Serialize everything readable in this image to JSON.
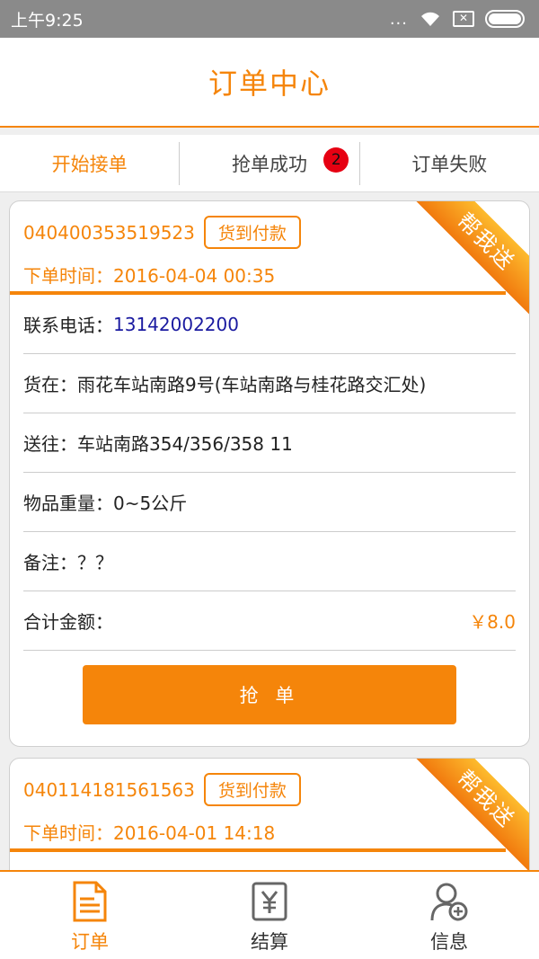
{
  "status_bar": {
    "time": "上午9:25",
    "dots": "...",
    "sim": "✕"
  },
  "header": {
    "title": "订单中心"
  },
  "tabs": [
    {
      "label": "开始接单",
      "active": true
    },
    {
      "label": "抢单成功",
      "badge": "2"
    },
    {
      "label": "订单失败"
    }
  ],
  "orders": [
    {
      "order_no": "040400353519523",
      "pay_type": "货到付款",
      "order_time": "下单时间：2016-04-04 00:35",
      "ribbon": "帮我送",
      "phone_label": "联系电话：",
      "phone": "13142002200",
      "pickup_label": "货在：",
      "pickup": "雨花车站南路9号(车站南路与桂花路交汇处)",
      "dest_label": "送往：",
      "dest": "车站南路354/356/358 11",
      "weight_label": "物品重量：",
      "weight": "0~5公斤",
      "note_label": "备注：",
      "note": "？？",
      "total_label": "合计金额：",
      "total": "￥8.0",
      "button": "抢 单"
    },
    {
      "order_no": "040114181561563",
      "pay_type": "货到付款",
      "order_time": "下单时间：2016-04-01 14:18",
      "ribbon": "帮我送"
    }
  ],
  "bottom_nav": [
    {
      "label": "订单",
      "icon": "order-doc-icon",
      "active": true
    },
    {
      "label": "结算",
      "icon": "settlement-yuan-icon"
    },
    {
      "label": "信息",
      "icon": "profile-plus-icon"
    }
  ],
  "colors": {
    "accent": "#f5850a",
    "badge": "#e60012",
    "phone": "#1a1aa0"
  }
}
